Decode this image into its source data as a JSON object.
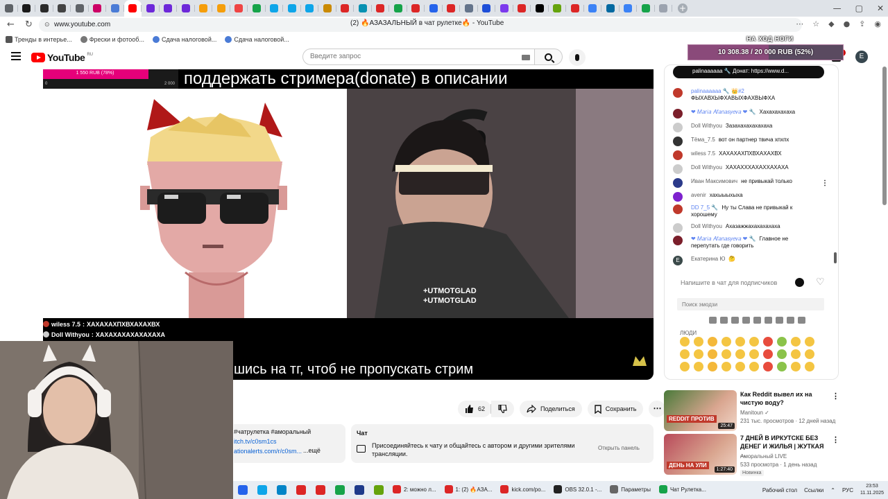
{
  "browser": {
    "tabs": [
      {
        "color": "#5f6368"
      },
      {
        "color": "#1a1a1a"
      },
      {
        "color": "#2b2b2b"
      },
      {
        "color": "#444"
      },
      {
        "color": "#5f6368"
      },
      {
        "color": "#cc0066"
      },
      {
        "color": "#4a7bd6"
      },
      {
        "color": "#ff0000",
        "active": true
      },
      {
        "color": "#6d28d9"
      },
      {
        "color": "#6d28d9"
      },
      {
        "color": "#6d28d9"
      },
      {
        "color": "#f59e0b"
      },
      {
        "color": "#f59e0b"
      },
      {
        "color": "#ef4444"
      },
      {
        "color": "#16a34a"
      },
      {
        "color": "#0ea5e9"
      },
      {
        "color": "#0ea5e9"
      },
      {
        "color": "#0ea5e9"
      },
      {
        "color": "#ca8a04"
      },
      {
        "color": "#dc2626"
      },
      {
        "color": "#0891b2"
      },
      {
        "color": "#dc2626"
      },
      {
        "color": "#16a34a"
      },
      {
        "color": "#dc2626"
      },
      {
        "color": "#2563eb"
      },
      {
        "color": "#dc2626"
      },
      {
        "color": "#64748b"
      },
      {
        "color": "#1d4ed8"
      },
      {
        "color": "#7c3aed"
      },
      {
        "color": "#dc2626"
      },
      {
        "color": "#000"
      },
      {
        "color": "#65a30d"
      },
      {
        "color": "#dc2626"
      },
      {
        "color": "#3b82f6"
      },
      {
        "color": "#0369a1"
      },
      {
        "color": "#3b82f6"
      },
      {
        "color": "#16a34a"
      },
      {
        "color": "#9ca3af"
      }
    ],
    "new_tab": "+",
    "url": "www.youtube.com",
    "page_title": "(2) 🔥АЗАЗАЛЬНЫЙ в чат рулетке🔥 - YouTube",
    "bookmarks": [
      "Тренды в интерье...",
      "Фрески и фотооб...",
      "Сдача налоговой...",
      "Сдача налоговой..."
    ]
  },
  "yt": {
    "logo_text": "YouTube",
    "country": "RU",
    "search_placeholder": "Введите запрос",
    "notif_count": "2",
    "avatar_letter": "E"
  },
  "stream": {
    "donation_goal_label": "НА ХОД НОГИ",
    "donation_goal_text": "10 308.38 / 20 000 RUB (52%)",
    "donation_goal_fraction": 0.52,
    "small_goal_text": "1 550 RUB (78%)",
    "small_goal_fraction": 0.78,
    "small_goal_min": "0",
    "small_goal_max": "2 000",
    "top_caption": "поддержать стримера(donate) в описании",
    "bottom_caption": "шись на тг, чтоб не пропускать стрим",
    "overlay_chat": [
      {
        "user": "wiless 7.5",
        "text": "ХАХАХАХПХВХАХАХВХ",
        "color": "#c0392b"
      },
      {
        "user": "Doll Withyou",
        "text": "ХАХАХАХАХАХАХАХА",
        "color": "#cccccc"
      }
    ]
  },
  "actions": {
    "like_count": "62",
    "share": "Поделиться",
    "save": "Сохранить",
    "more": "⋯"
  },
  "description": {
    "tags": "#чатрулетка #аморальный",
    "link1": "itch.tv/c0sm1cs",
    "link2": "ationalerts.com/r/c0sm...",
    "more": "...ещё"
  },
  "chat_panel": {
    "title": "Чат",
    "text": "Присоединяйтесь к чату и общайтесь с автором и другими зрителями трансляции.",
    "button": "Открыть панель"
  },
  "livechat": {
    "pinned": "palinaaaaaa 🔧  Донат: https://www.d...",
    "messages": [
      {
        "author": "palinaaaaaa 🔧  👑#2",
        "text": "ФЫХАВХЫФХАВЫХФАХВЫФХА",
        "mod": true,
        "color": "#c0392b"
      },
      {
        "author": "❤ 𝑀𝑎𝑟𝑖𝑎 𝐴𝑓𝑎𝑛𝑎𝑠𝑦𝑒𝑣𝑎 ❤ 🔧",
        "text": "Хахахахахаха",
        "mod": true,
        "color": "#7b1f2b"
      },
      {
        "author": "Doll Withyou",
        "text": "Зазахахахахахаха",
        "mod": false,
        "color": "#cccccc"
      },
      {
        "author": "Тёма_7.5",
        "text": "вот он партнер твича хпхпх",
        "mod": false,
        "color": "#333333"
      },
      {
        "author": "wiless 7.5",
        "text": "ХАХАХАХПХВХАХАХВХ",
        "mod": false,
        "color": "#c0392b"
      },
      {
        "author": "Doll Withyou",
        "text": "ХАХАХХХАХАХХАХАХА",
        "mod": false,
        "color": "#cccccc"
      },
      {
        "author": "Иван Максимович",
        "text": "не привыкай только",
        "mod": false,
        "color": "#2b3a8a"
      },
      {
        "author": "avenir",
        "text": "хахыыыхыха",
        "mod": false,
        "color": "#7e22ce"
      },
      {
        "author": "DD 7_5 🔧",
        "text": "Ну ты Слава не привыкай к хорошему",
        "mod": true,
        "color": "#c0392b"
      },
      {
        "author": "Doll Withyou",
        "text": "Ахазажжахахахахаха",
        "mod": false,
        "color": "#cccccc"
      },
      {
        "author": "❤ 𝑀𝑎𝑟𝑖𝑎 𝐴𝑓𝑎𝑛𝑎𝑠𝑦𝑒𝑣𝑎 ❤ 🔧",
        "text": "Главное не перепутать где говорить",
        "mod": true,
        "color": "#7b1f2b"
      },
      {
        "author": "Екатерина Ю",
        "text": "🤔",
        "mod": false,
        "color": "#3b4a4a",
        "letter": "Е"
      }
    ],
    "input_placeholder": "Напишите в чат для подписчиков",
    "emoji_search": "Поиск эмодзи",
    "emoji_section": "ЛЮДИ"
  },
  "recommendations": [
    {
      "title": "Как Reddit вывел их на чистую воду?",
      "channel": "Manitoun ✓",
      "meta": "231 тыс. просмотров · 12 дней назад",
      "duration": "25:47",
      "thumb_text": "REDDIT ПРОТИВ",
      "thumb_color": "#4a7a3a"
    },
    {
      "title": "7 ДНЕЙ В ИРКУТСКЕ БЕЗ ДЕНЕГ И ЖИЛЬЯ | ЖУТКАЯ ...",
      "channel": "Аморальный LIVE",
      "meta": "533 просмотра · 1 день назад",
      "badge": "Новинка",
      "duration": "1:27:40",
      "thumb_text": "ДЕНЬ НА УЛИ",
      "thumb_color": "#b84a5a"
    }
  ],
  "taskbar": {
    "apps": [
      {
        "label": "2: можно л...",
        "color": "#dc2626"
      },
      {
        "label": "1: (2) 🔥АЗА...",
        "color": "#dc2626"
      },
      {
        "label": "kick.com/po...",
        "color": "#dc2626"
      },
      {
        "label": "OBS 32.0.1 -...",
        "color": "#222222"
      },
      {
        "label": "Параметры",
        "color": "#666666"
      },
      {
        "label": "Чат Рулетка...",
        "color": "#16a34a"
      }
    ],
    "pinned": [
      {
        "color": "#2563eb"
      },
      {
        "color": "#0ea5e9"
      },
      {
        "color": "#0284c7"
      },
      {
        "color": "#dc2626"
      },
      {
        "color": "#dc2626"
      },
      {
        "color": "#16a34a"
      },
      {
        "color": "#1e3a8a"
      },
      {
        "color": "#65a30d"
      }
    ],
    "desktop": "Рабочий стол",
    "links": "Ссылки",
    "lang": "РУС",
    "time": "23:53",
    "date": "11.11.2025"
  }
}
